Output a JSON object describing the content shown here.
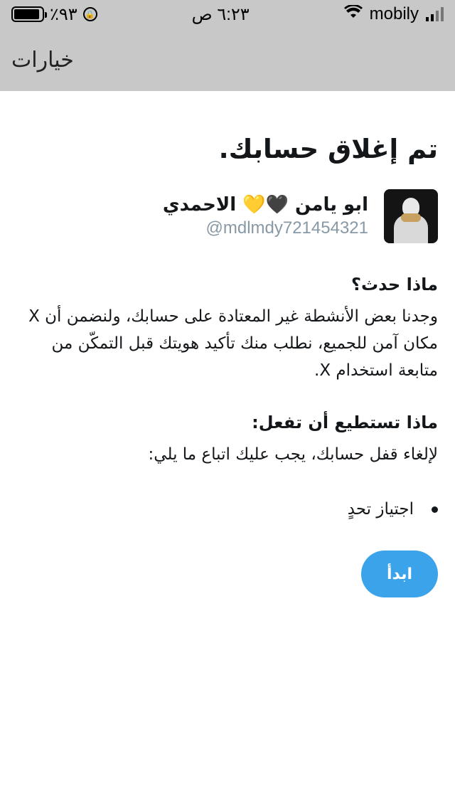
{
  "status_bar": {
    "battery": "٪٩٣",
    "time": "٦:٢٣ ص",
    "carrier": "mobily",
    "battery_level": 0.93
  },
  "nav": {
    "options_label": "خيارات"
  },
  "main": {
    "title": "تم إغلاق حسابك.",
    "account": {
      "display_name": "ابو يامن 🖤💛 الاحمدي",
      "handle": "@mdlmdy721454321"
    },
    "what_happened_heading": "ماذا حدث؟",
    "what_happened_text": "وجدنا بعض الأنشطة غير المعتادة على حسابك، ولنضمن أن X مكان آمن للجميع، نطلب منك تأكيد هويتك قبل التمكّن من متابعة استخدام X.",
    "what_you_can_do_heading": "ماذا تستطيع أن تفعل:",
    "what_you_can_do_text": "لإلغاء قفل حسابك، يجب عليك اتباع ما يلي:",
    "steps": [
      "اجتياز تحدٍ"
    ],
    "start_button": "ابدأ"
  },
  "colors": {
    "accent": "#3aa3ea",
    "header_bg": "#c8c8c8",
    "handle_gray": "#8899a6"
  }
}
